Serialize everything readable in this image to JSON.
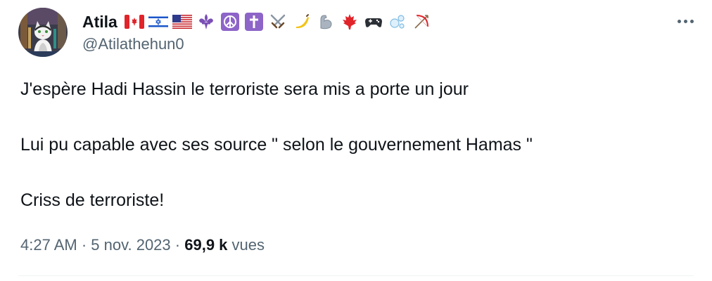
{
  "author": {
    "display_name": "Atila",
    "handle": "@Atilathehun0",
    "avatar_icon": "cat-avatar-icon",
    "name_badges": [
      "canada-flag-icon",
      "israel-flag-icon",
      "usa-flag-icon",
      "fleur-de-lis-icon",
      "peace-symbol-icon",
      "latin-cross-icon",
      "crossed-swords-icon",
      "banana-icon",
      "flexed-biceps-icon",
      "maple-leaf-icon",
      "video-game-icon",
      "bubbles-icon",
      "bow-and-arrow-icon"
    ]
  },
  "tweet": {
    "lines": [
      "J'espère Hadi Hassin le terroriste sera mis a porte un jour",
      "Lui pu capable avec ses source \" selon le gouvernement Hamas \"",
      "Criss de terroriste!"
    ],
    "time": "4:27 AM",
    "separator": "·",
    "date": "5 nov. 2023",
    "views_count": "69,9 k",
    "views_label": "vues"
  },
  "more_icon": "more-horizontal-icon",
  "colors": {
    "text": "#0f1419",
    "secondary": "#536471",
    "divider": "#eff3f4"
  }
}
